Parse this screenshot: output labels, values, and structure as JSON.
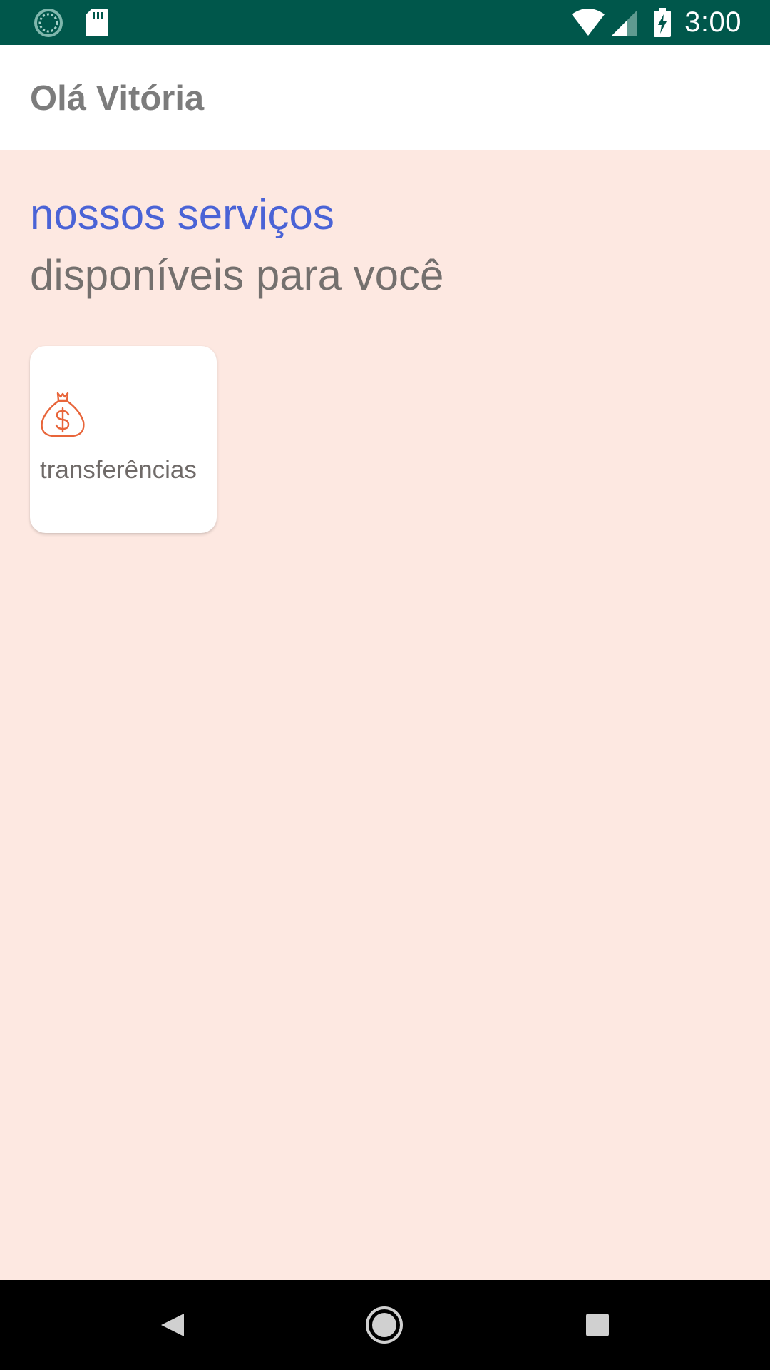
{
  "status_bar": {
    "time": "3:00",
    "background": "#00574b",
    "left_icons": [
      "spinner-icon",
      "sd-card-icon"
    ],
    "right_icons": [
      "wifi-icon",
      "signal-icon",
      "battery-charging-icon"
    ]
  },
  "app_bar": {
    "greeting": "Olá Vitória"
  },
  "main": {
    "heading_accent": "nossos serviços",
    "heading_sub": "disponíveis para você",
    "services": [
      {
        "label": "transferências",
        "icon": "money-bag-icon",
        "icon_color": "#e8653a"
      }
    ]
  },
  "nav_bar": {
    "buttons": [
      "back-icon",
      "home-icon",
      "recent-apps-icon"
    ]
  },
  "colors": {
    "background": "#fde8e1",
    "accent": "#4a63d6",
    "text_muted": "#74706e"
  }
}
